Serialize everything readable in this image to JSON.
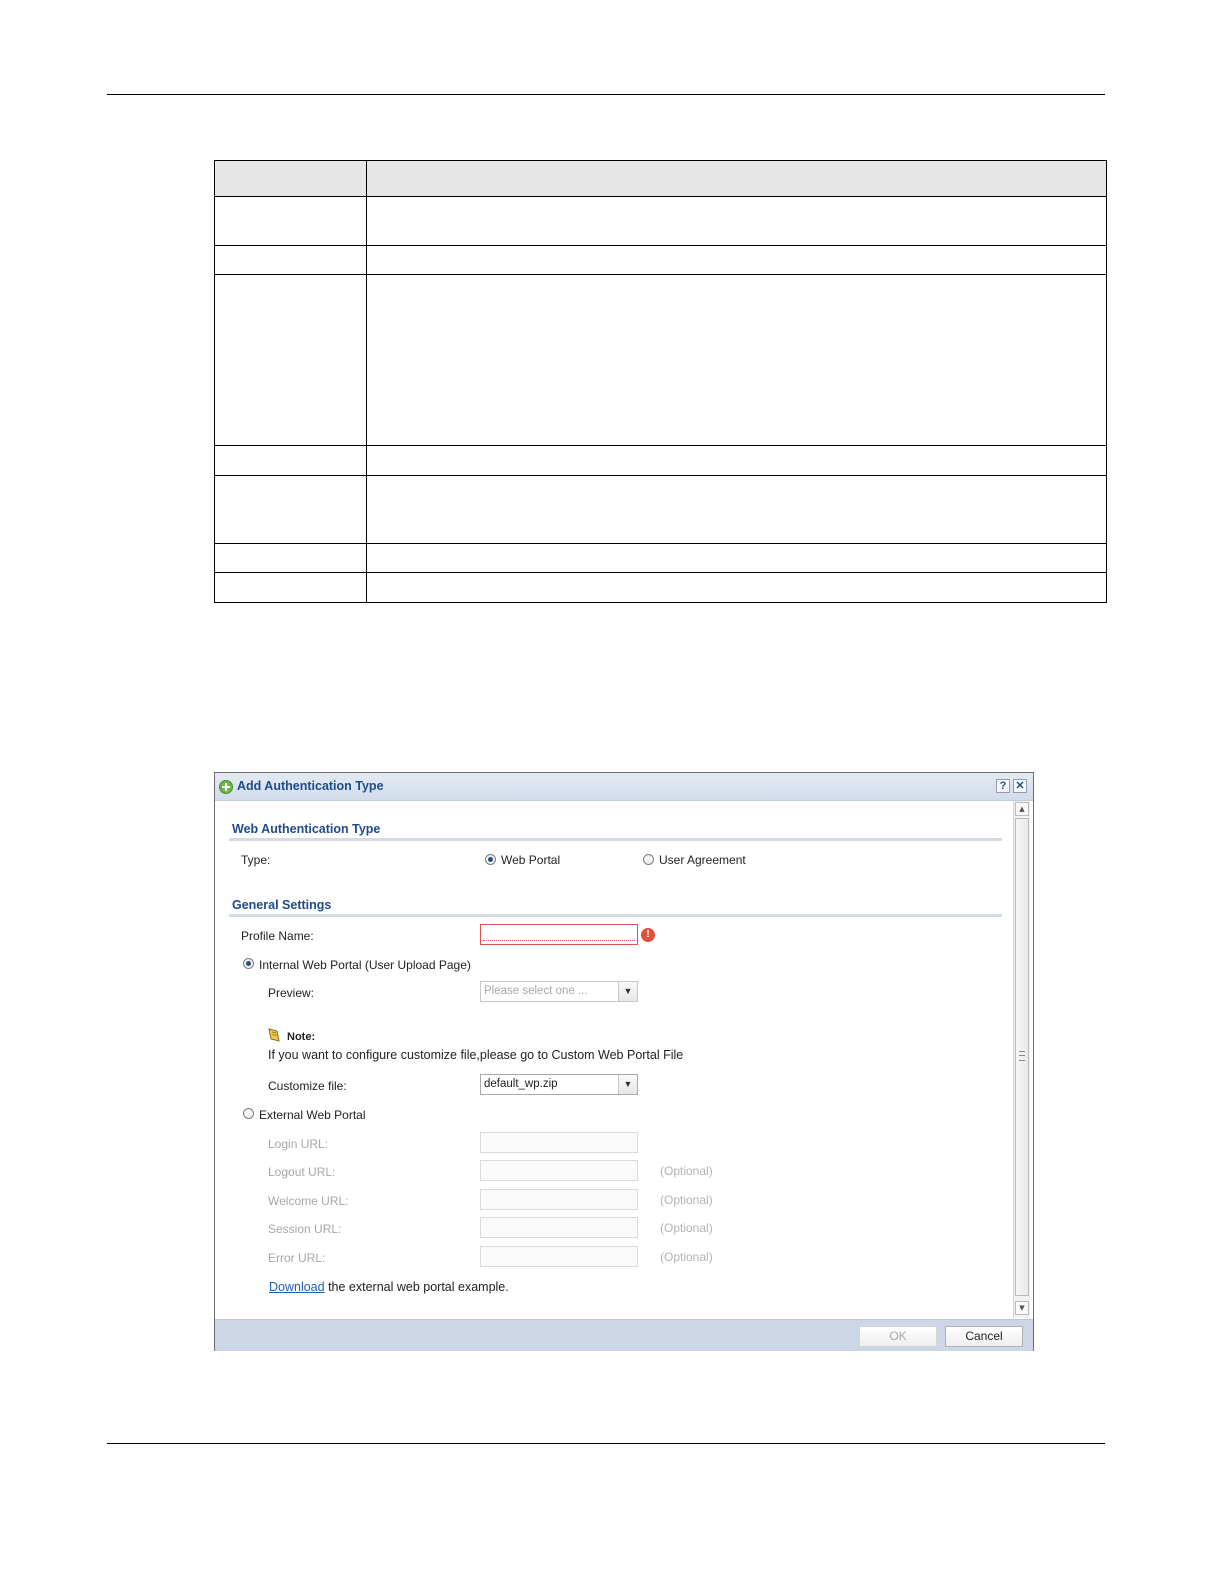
{
  "dialog": {
    "title": "Add Authentication Type",
    "help_glyph": "?",
    "close_glyph": "✕",
    "web_auth_section": {
      "title": "Web Authentication Type",
      "type_label": "Type:",
      "options": [
        {
          "label": "Web Portal",
          "checked": true
        },
        {
          "label": "User Agreement",
          "checked": false
        }
      ]
    },
    "general_section": {
      "title": "General Settings",
      "profile_name_label": "Profile Name:",
      "profile_name_value": "",
      "error_glyph": "!",
      "internal_portal_label": "Internal Web Portal (User Upload Page)",
      "preview_label": "Preview:",
      "preview_placeholder": "Please select one ...",
      "note_title": "Note:",
      "note_text": "If you want to configure customize file,please go to Custom Web Portal File",
      "customize_file_label": "Customize file:",
      "customize_file_value": "default_wp.zip",
      "external_portal_label": "External Web Portal",
      "url_fields": [
        {
          "label": "Login URL:",
          "optional": ""
        },
        {
          "label": "Logout URL:",
          "optional": "(Optional)"
        },
        {
          "label": "Welcome URL:",
          "optional": "(Optional)"
        },
        {
          "label": "Session URL:",
          "optional": "(Optional)"
        },
        {
          "label": "Error URL:",
          "optional": "(Optional)"
        }
      ],
      "download_link": "Download",
      "download_text": " the external web portal example."
    },
    "buttons": {
      "ok": "OK",
      "cancel": "Cancel"
    }
  }
}
